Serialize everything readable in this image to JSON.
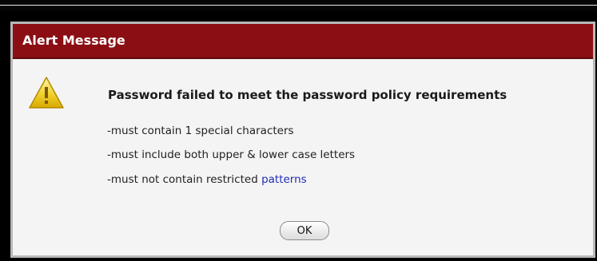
{
  "dialog": {
    "title": "Alert Message",
    "headline": "Password failed to meet the password policy requirements",
    "requirements": [
      "-must contain 1 special characters",
      "-must include both upper & lower case letters",
      "-must not contain restricted "
    ],
    "link_text": "patterns",
    "ok_label": "OK",
    "icon": "warning-icon"
  },
  "colors": {
    "titlebar": "#8a0e14",
    "link": "#1f2db7"
  }
}
